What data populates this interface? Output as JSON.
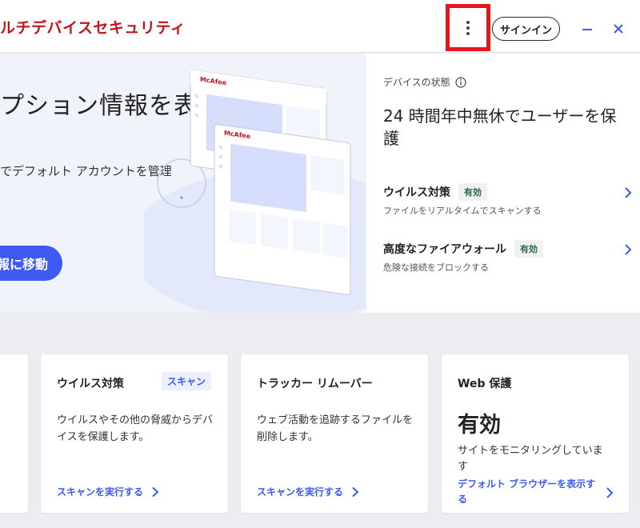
{
  "app": {
    "title": "ルチデバイスセキュリティ"
  },
  "titlebar": {
    "signin_label": "サインイン"
  },
  "hero": {
    "title": "プション情報を表",
    "description": "でデフォルト アカウントを管理",
    "button_label": "報に移動",
    "illustration_brand": "McAfee"
  },
  "device_status": {
    "label": "デバイスの状態",
    "headline": "24 時間年中無休でユーザーを保護",
    "features": [
      {
        "title": "ウイルス対策",
        "badge": "有効",
        "description": "ファイルをリアルタイムでスキャンする"
      },
      {
        "title": "高度なファイアウォール",
        "badge": "有効",
        "description": "危険な接続をブロックする"
      }
    ]
  },
  "cards": [
    {
      "title": "ウイルス対策",
      "badge": "スキャン",
      "description": "ウイルスやその他の脅威からデバイスを保護します。",
      "link": "スキャンを実行する"
    },
    {
      "title": "トラッカー リムーバー",
      "description": "ウェブ活動を追跡するファイルを削除します。",
      "link": "スキャンを実行する"
    },
    {
      "title": "Web 保護",
      "status": "有効",
      "description": "サイトをモニタリングしています",
      "link": "デフォルト ブラウザーを表示する"
    }
  ],
  "colors": {
    "brand_red": "#c0161c",
    "accent_blue": "#3d5af1",
    "highlight_red": "#e8141b",
    "badge_green": "#2e6b46"
  }
}
